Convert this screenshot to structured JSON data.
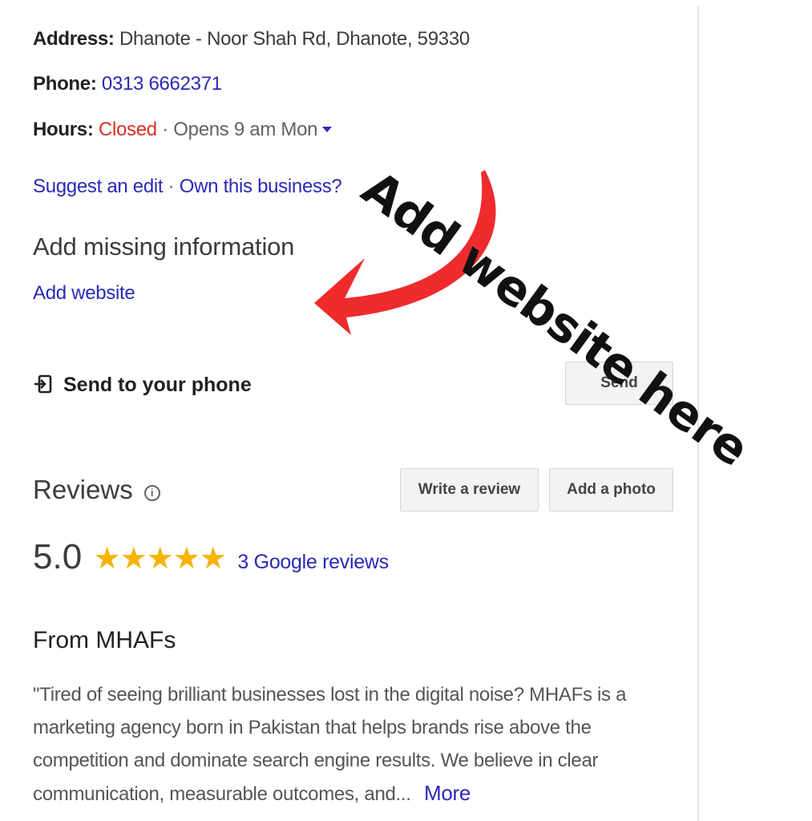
{
  "address": {
    "label": "Address:",
    "value": "Dhanote - Noor Shah Rd, Dhanote, 59330"
  },
  "phone": {
    "label": "Phone:",
    "value": "0313 6662371"
  },
  "hours": {
    "label": "Hours:",
    "status": "Closed",
    "separator": "·",
    "opens": "Opens 9 am Mon"
  },
  "links": {
    "suggest_edit": "Suggest an edit",
    "separator": "·",
    "own_business": "Own this business?"
  },
  "missing": {
    "heading": "Add missing information",
    "add_website": "Add website"
  },
  "send": {
    "label": "Send to your phone",
    "button": "Send"
  },
  "reviews": {
    "title": "Reviews",
    "info_icon": "info-icon",
    "write_button": "Write a review",
    "photo_button": "Add a photo",
    "rating": "5.0",
    "stars": "★★★★★",
    "star_count": 5,
    "count_link": "3 Google reviews"
  },
  "from": {
    "title": "From MHAFs",
    "description": "\"Tired of seeing brilliant businesses lost in the digital noise? MHAFs is a marketing agency born in Pakistan that helps brands rise above the competition and dominate search engine results. We believe in clear communication, measurable outcomes, and...",
    "more_link": "More"
  },
  "annotation": {
    "text": "Add website here",
    "arrow_color": "#ef2b2d"
  },
  "colors": {
    "link": "#2a29b8",
    "closed": "#d93025",
    "star": "#f4b400"
  }
}
